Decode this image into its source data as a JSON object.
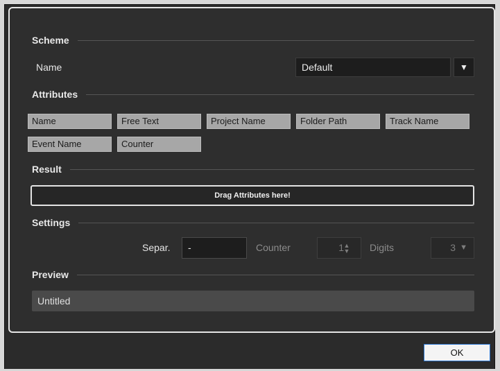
{
  "scheme": {
    "title": "Scheme",
    "name_label": "Name",
    "selected": "Default",
    "arrow_icon": "▼"
  },
  "attributes": {
    "title": "Attributes",
    "items": [
      "Name",
      "Free Text",
      "Project Name",
      "Folder Path",
      "Track Name",
      "Event Name",
      "Counter"
    ]
  },
  "result": {
    "title": "Result",
    "dropzone_text": "Drag Attributes here!"
  },
  "settings": {
    "title": "Settings",
    "separator_label": "Separ.",
    "separator_value": "-",
    "counter_label": "Counter",
    "counter_value": "1",
    "counter_icon": "▲▼",
    "digits_label": "Digits",
    "digits_value": "3",
    "digits_icon": "▼"
  },
  "preview": {
    "title": "Preview",
    "value": "Untitled"
  },
  "footer": {
    "ok_label": "OK"
  }
}
